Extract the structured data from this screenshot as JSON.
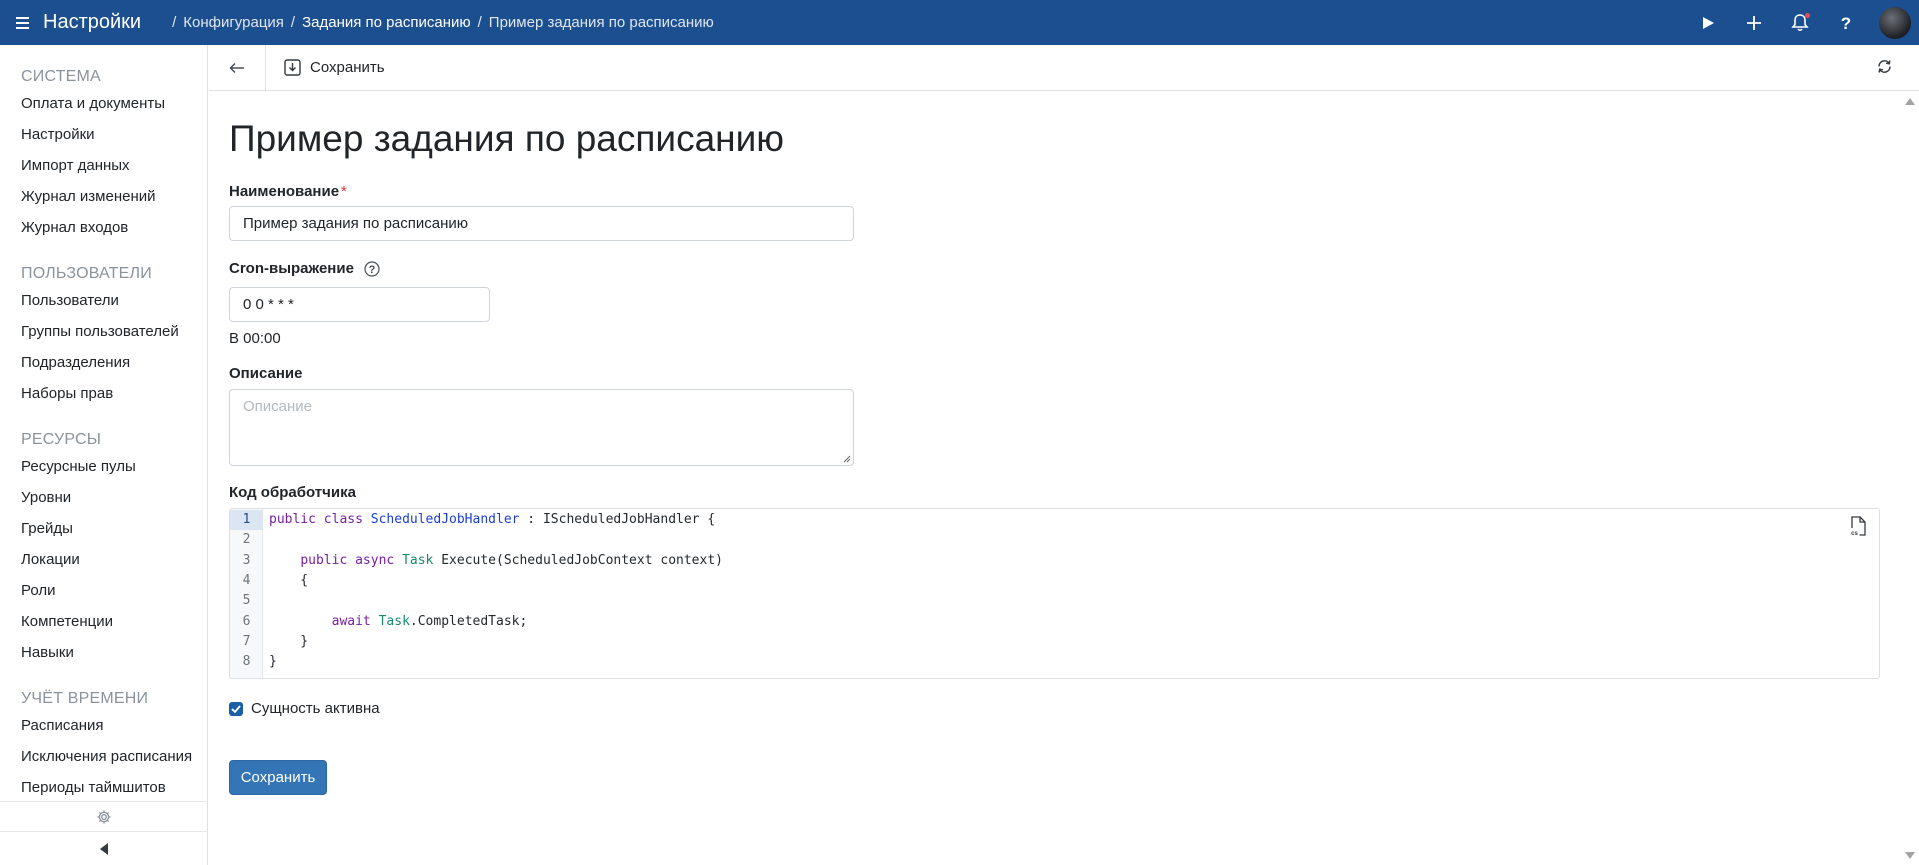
{
  "topbar": {
    "app_title": "Настройки",
    "breadcrumb": [
      {
        "label": "Конфигурация"
      },
      {
        "label": "Задания по расписанию"
      },
      {
        "label": "Пример задания по расписанию"
      }
    ],
    "icons": [
      "menu-icon",
      "play-icon",
      "plus-icon",
      "bell-icon",
      "help-icon",
      "avatar"
    ],
    "bell_has_notification": true,
    "color": "#1c4f8f"
  },
  "sidebar": {
    "sections": [
      {
        "title": "Система",
        "items": [
          "Оплата и документы",
          "Настройки",
          "Импорт данных",
          "Журнал изменений",
          "Журнал входов"
        ]
      },
      {
        "title": "Пользователи",
        "items": [
          "Пользователи",
          "Группы пользователей",
          "Подразделения",
          "Наборы прав"
        ]
      },
      {
        "title": "Ресурсы",
        "items": [
          "Ресурсные пулы",
          "Уровни",
          "Грейды",
          "Локации",
          "Роли",
          "Компетенции",
          "Навыки"
        ]
      },
      {
        "title": "Учёт времени",
        "items": [
          "Расписания",
          "Исключения расписания",
          "Периоды таймшитов"
        ]
      }
    ],
    "bottom_icons": [
      "gear-icon",
      "collapse-left-icon"
    ]
  },
  "toolbar": {
    "save_label": "Сохранить",
    "icons": [
      "back-arrow-icon",
      "save-icon",
      "refresh-icon"
    ]
  },
  "form": {
    "page_title": "Пример задания по расписанию",
    "name_label": "Наименование",
    "name_value": "Пример задания по расписанию",
    "cron_label": "Cron-выражение",
    "cron_value": "0 0 * * *",
    "cron_hint": "В 00:00",
    "description_label": "Описание",
    "description_placeholder": "Описание",
    "handler_label": "Код обработчика",
    "code_lines": [
      "public class ScheduledJobHandler : IScheduledJobHandler {",
      "",
      "    public async Task Execute(ScheduledJobContext context)",
      "    {",
      "",
      "        await Task.CompletedTask;",
      "    }",
      "}"
    ],
    "active_line": 1,
    "active_label": "Сущность активна",
    "active_checked": true,
    "save_button": "Сохранить",
    "accent_color": "#3475b5"
  }
}
